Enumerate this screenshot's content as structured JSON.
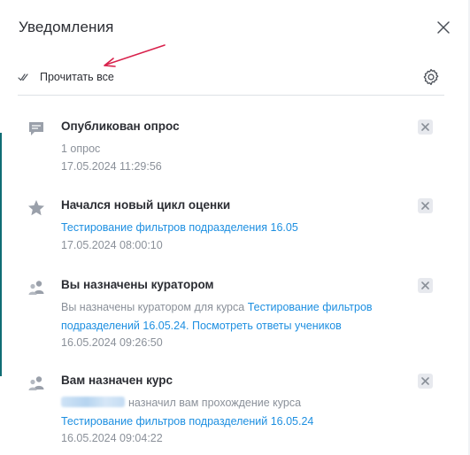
{
  "header": {
    "title": "Уведомления"
  },
  "toolbar": {
    "read_all_label": "Прочитать все"
  },
  "notifications": [
    {
      "icon": "chat-bubble-icon",
      "title": "Опубликован опрос",
      "body_text": "1 опрос",
      "date": "17.05.2024 11:29:56"
    },
    {
      "icon": "star-icon",
      "title": "Начался новый цикл оценки",
      "link": "Тестирование фильтров подразделения 16.05",
      "date": "17.05.2024 08:00:10"
    },
    {
      "icon": "users-icon",
      "title": "Вы назначены куратором",
      "body_text": "Вы назначены куратором для курса ",
      "link": "Тестирование фильтров подразделений 16.05.24. Посмотреть ответы учеников",
      "date": "16.05.2024 09:26:50"
    },
    {
      "icon": "users-icon",
      "title": "Вам назначен курс",
      "body_text": "назначил вам прохождение курса",
      "link": "Тестирование фильтров подразделений 16.05.24",
      "date": "16.05.2024 09:04:22"
    }
  ],
  "colors": {
    "link": "#1d8fe1",
    "muted": "#8a9099",
    "annotation_arrow": "#d8204b",
    "icon": "#9aa0aa"
  }
}
